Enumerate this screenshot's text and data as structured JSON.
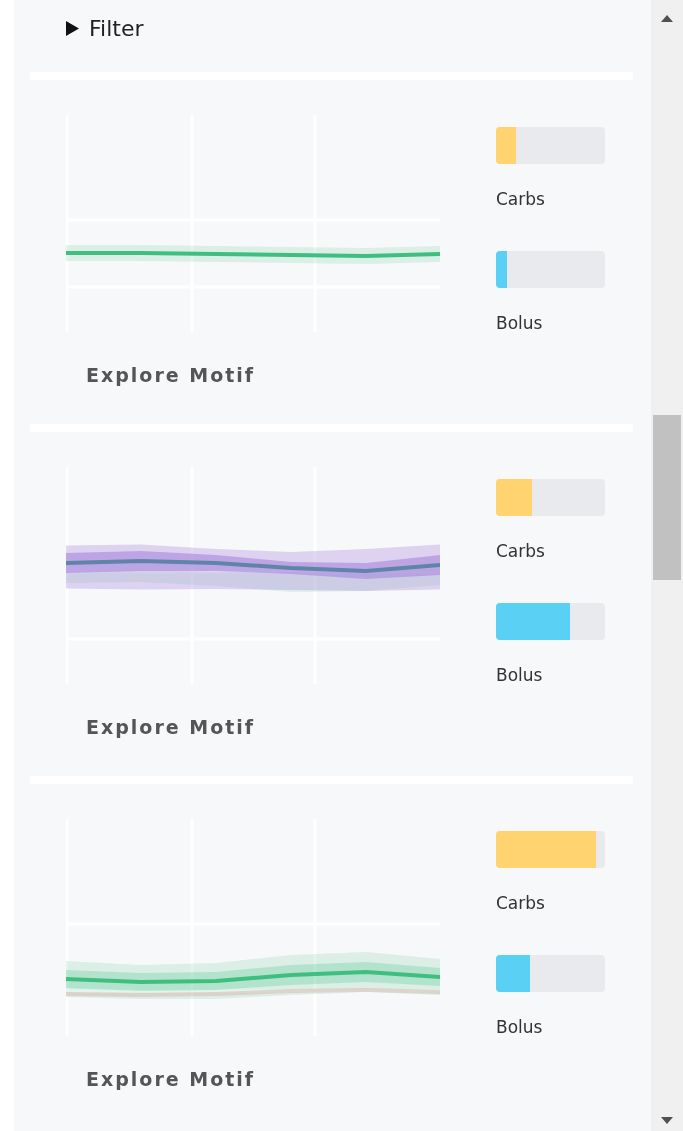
{
  "filter": {
    "label": "Filter",
    "expanded": false
  },
  "cards": [
    {
      "kind": "flat",
      "bars": [
        {
          "label": "Carbs",
          "kind": "carbs",
          "level": 0.18
        },
        {
          "label": "Bolus",
          "kind": "bolus",
          "level": 0.1
        }
      ],
      "action": "Explore Motif"
    },
    {
      "kind": "wave",
      "bars": [
        {
          "label": "Carbs",
          "kind": "carbs",
          "level": 0.33
        },
        {
          "label": "Bolus",
          "kind": "bolus",
          "level": 0.68
        }
      ],
      "action": "Explore Motif"
    },
    {
      "kind": "rise",
      "bars": [
        {
          "label": "Carbs",
          "kind": "carbs",
          "level": 0.92
        },
        {
          "label": "Bolus",
          "kind": "bolus",
          "level": 0.31
        }
      ],
      "action": "Explore Motif"
    }
  ]
}
